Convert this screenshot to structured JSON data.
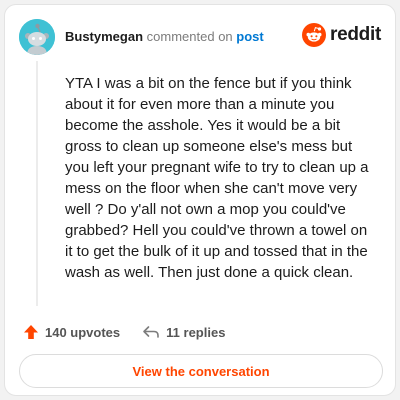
{
  "header": {
    "username": "Bustymegan",
    "action_text": "commented on",
    "post_link": "post",
    "brand": "reddit"
  },
  "avatar": {
    "icon": "snoo-avatar",
    "background": "#3fc1d4"
  },
  "comment": {
    "body": "YTA I was a bit on the fence but if you think about it for even more than a minute you become the asshole. Yes it would be a bit gross to clean up someone else's mess but you left your pregnant wife to try to clean up a mess on the floor when she can't move very well ? Do y'all not own a mop you could've grabbed? Hell you could've thrown a towel on it to get the bulk of it up and tossed that in the wash as well. Then just done a quick clean."
  },
  "actions": {
    "upvotes": "140 upvotes",
    "replies": "11 replies"
  },
  "cta": {
    "label": "View the conversation"
  },
  "colors": {
    "brand_orange": "#ff4500",
    "link_blue": "#0079d3"
  }
}
